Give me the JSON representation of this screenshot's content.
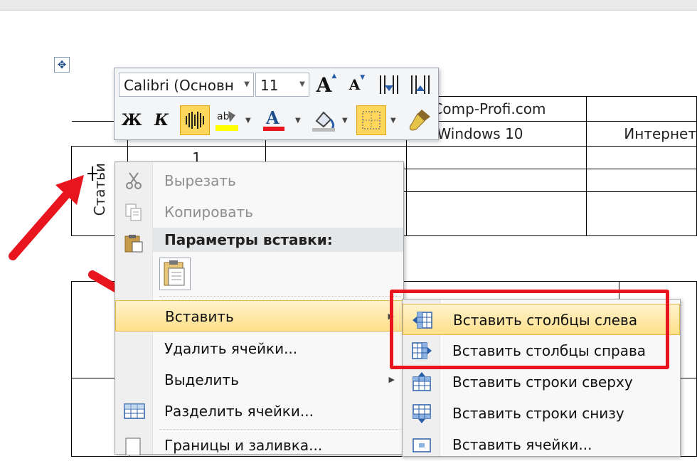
{
  "document": {
    "cell_url": "Comp-Profi.com",
    "cell_win10": "Windows 10",
    "cell_internet": "Интернет",
    "cell_number": "1",
    "cell_vertical": "Статьи"
  },
  "mini_toolbar": {
    "font_name": "Calibri (Основн",
    "font_size": "11",
    "icons": [
      "grow-font-icon",
      "shrink-font-icon",
      "decrease-indent-icon",
      "increase-indent-icon",
      "bold-icon",
      "italic-icon",
      "center-align-icon",
      "highlight-icon",
      "font-color-icon",
      "shading-icon",
      "borders-icon",
      "format-painter-icon"
    ],
    "bold_label": "Ж",
    "italic_label": "К",
    "highlight_color": "#ffff00",
    "font_color": "#e8141e"
  },
  "context_menu": {
    "items": [
      {
        "label": "Вырезать",
        "icon": "scissors-icon",
        "disabled": true
      },
      {
        "label": "Копировать",
        "icon": "copy-icon",
        "disabled": true
      },
      {
        "label": "Вставить",
        "icon": "",
        "highlighted": true,
        "submenu": true
      },
      {
        "label": "Удалить ячейки...",
        "icon": ""
      },
      {
        "label": "Выделить",
        "icon": "",
        "submenu": true
      },
      {
        "label": "Разделить ячейки...",
        "icon": "split-cells-icon"
      },
      {
        "label": "Границы и заливка...",
        "icon": "borders-icon"
      }
    ],
    "paste_section_label": "Параметры вставки:",
    "paste_icon": "paste-keep-format-icon"
  },
  "submenu": {
    "items": [
      {
        "label": "Вставить столбцы слева",
        "icon": "insert-columns-left-icon",
        "highlighted": true
      },
      {
        "label": "Вставить столбцы справа",
        "icon": "insert-columns-right-icon"
      },
      {
        "label": "Вставить строки сверху",
        "icon": "insert-rows-above-icon"
      },
      {
        "label": "Вставить строки снизу",
        "icon": "insert-rows-below-icon"
      },
      {
        "label": "Вставить ячейки...",
        "icon": "insert-cells-icon"
      }
    ]
  },
  "colors": {
    "highlight_accent": "#ffe08a",
    "annotation_red": "#e8141e"
  }
}
